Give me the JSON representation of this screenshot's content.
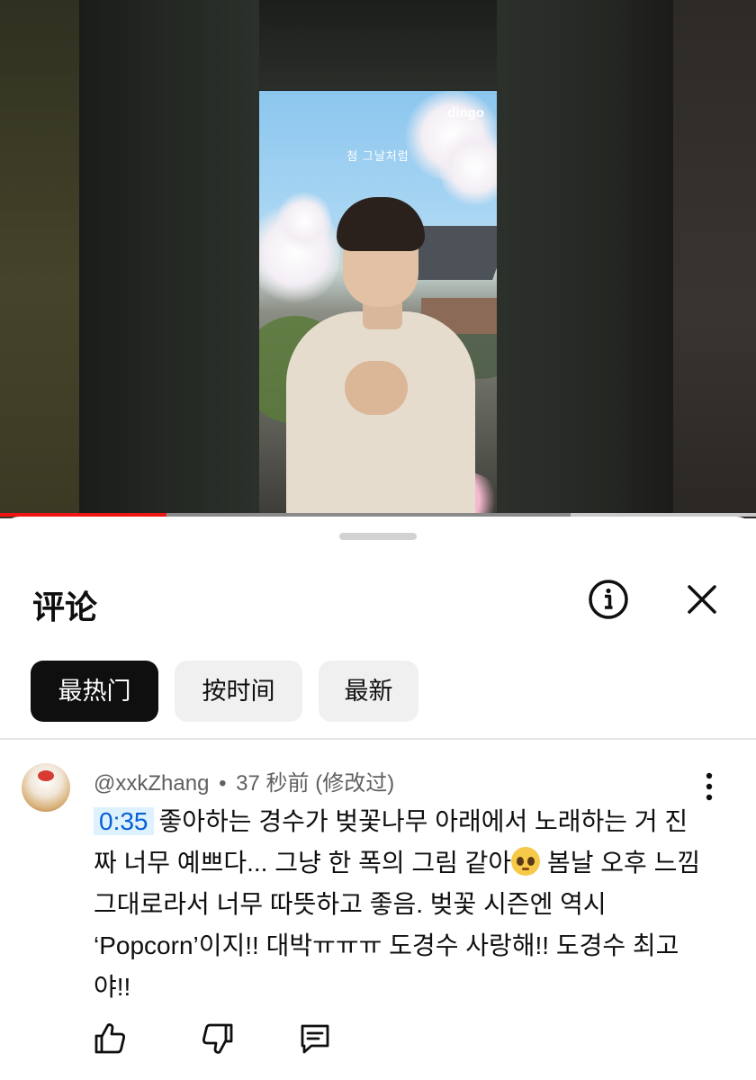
{
  "video": {
    "overlay_text": "첨 그날처럼",
    "logo": "dingo",
    "progress_played": 0.22,
    "progress_buffered_start": 0.755,
    "progress_buffered_end": 1.0
  },
  "comments_panel": {
    "title": "评论",
    "info_icon": "info-icon",
    "close_icon": "close-icon",
    "sort_chips": [
      {
        "label": "最热门",
        "active": true
      },
      {
        "label": "按时间",
        "active": false
      },
      {
        "label": "最新",
        "active": false
      }
    ]
  },
  "comment": {
    "author": "@xxkZhang",
    "separator": "•",
    "time": "37 秒前",
    "edited": "(修改过)",
    "timestamp_link": "0:35",
    "text_part1": "좋아하는 경수가 벚꽃나무 아래에서 노래하는 거 진짜 너무 예쁘다... 그냥 한 폭의 그림 같아",
    "emoji": "pleading-face",
    "text_part2": " 봄날 오후 느낌 그대로라서 너무 따뜻하고 좋음. 벚꽃 시즌엔 역시 ‘Popcorn’이지!! 대박ㅠㅠㅠ 도경수 사랑해!! 도경수 최고야!!",
    "actions": [
      "like-icon",
      "dislike-icon",
      "reply-icon"
    ]
  },
  "colors": {
    "progress_red": "#f01515",
    "link_blue": "#065fd4",
    "chip_active_bg": "#0f0f0f",
    "chip_bg": "#f0f0f0"
  }
}
